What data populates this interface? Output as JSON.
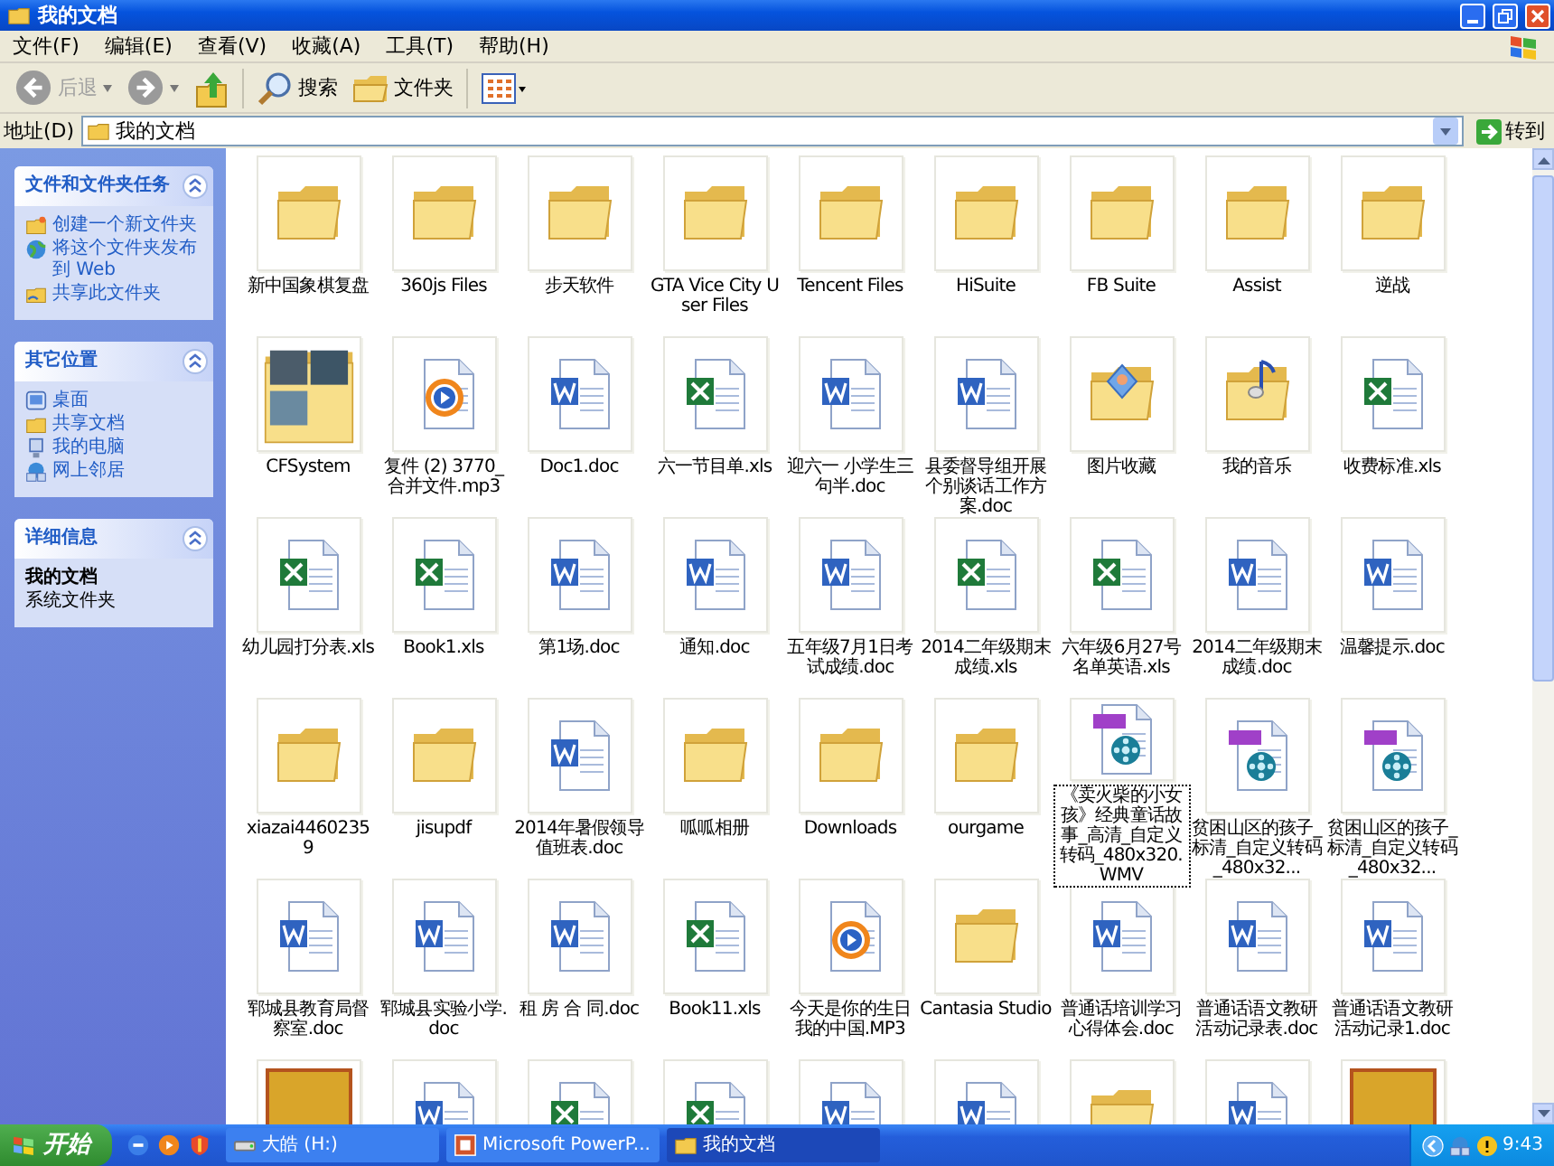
{
  "window": {
    "title": "我的文档"
  },
  "menu": [
    {
      "label": "文件(F)"
    },
    {
      "label": "编辑(E)"
    },
    {
      "label": "查看(V)"
    },
    {
      "label": "收藏(A)"
    },
    {
      "label": "工具(T)"
    },
    {
      "label": "帮助(H)"
    }
  ],
  "toolbar": [
    {
      "kind": "back",
      "label": "后退",
      "disabled": true
    },
    {
      "kind": "forward",
      "disabled": true
    },
    {
      "kind": "up",
      "disabled": false
    },
    {
      "kind": "search",
      "label": "搜索"
    },
    {
      "kind": "folders",
      "label": "文件夹"
    },
    {
      "kind": "views"
    }
  ],
  "address": {
    "label": "地址(D)",
    "value": "我的文档",
    "go": "转到"
  },
  "sidebar": [
    {
      "title": "文件和文件夹任务",
      "kind": "links",
      "items": [
        {
          "label": "创建一个新文件夹",
          "kind": "new-folder"
        },
        {
          "label": "将这个文件夹发布到 Web",
          "kind": "publish"
        },
        {
          "label": "共享此文件夹",
          "kind": "share"
        }
      ]
    },
    {
      "title": "其它位置",
      "kind": "links",
      "items": [
        {
          "label": "桌面",
          "kind": "desktop"
        },
        {
          "label": "共享文档",
          "kind": "folder"
        },
        {
          "label": "我的电脑",
          "kind": "computer"
        },
        {
          "label": "网上邻居",
          "kind": "network"
        }
      ]
    },
    {
      "title": "详细信息",
      "kind": "details",
      "name": "我的文档",
      "type": "系统文件夹"
    }
  ],
  "files": [
    {
      "name": "新中国象棋复盘",
      "kind": "folder",
      "selected": false
    },
    {
      "name": "360js Files",
      "kind": "folder",
      "selected": false
    },
    {
      "name": "步天软件",
      "kind": "folder",
      "selected": false
    },
    {
      "name": "GTA Vice City User Files",
      "kind": "folder",
      "selected": false
    },
    {
      "name": "Tencent Files",
      "kind": "folder",
      "selected": false
    },
    {
      "name": "HiSuite",
      "kind": "folder",
      "selected": false
    },
    {
      "name": "FB Suite",
      "kind": "folder",
      "selected": false
    },
    {
      "name": "Assist",
      "kind": "folder",
      "selected": false
    },
    {
      "name": "逆战",
      "kind": "folder",
      "selected": false
    },
    {
      "name": "CFSystem",
      "kind": "folder-photos",
      "selected": false
    },
    {
      "name": "复件 (2) 3770_合并文件.mp3",
      "kind": "media",
      "selected": false
    },
    {
      "name": "Doc1.doc",
      "kind": "doc",
      "selected": false
    },
    {
      "name": "六一节目单.xls",
      "kind": "xls",
      "selected": false
    },
    {
      "name": "迎六一 小学生三句半.doc",
      "kind": "doc",
      "selected": false
    },
    {
      "name": "县委督导组开展个别谈话工作方案.doc",
      "kind": "doc",
      "selected": false
    },
    {
      "name": "图片收藏",
      "kind": "folder-pictures",
      "selected": false
    },
    {
      "name": "我的音乐",
      "kind": "folder-music",
      "selected": false
    },
    {
      "name": "收费标准.xls",
      "kind": "xls",
      "selected": false
    },
    {
      "name": "幼儿园打分表.xls",
      "kind": "xls",
      "selected": false
    },
    {
      "name": "Book1.xls",
      "kind": "xls",
      "selected": false
    },
    {
      "name": "第1场.doc",
      "kind": "doc",
      "selected": false
    },
    {
      "name": "通知.doc",
      "kind": "doc",
      "selected": false
    },
    {
      "name": "五年级7月1日考试成绩.doc",
      "kind": "doc",
      "selected": false
    },
    {
      "name": "2014二年级期末成绩.xls",
      "kind": "xls",
      "selected": false
    },
    {
      "name": "六年级6月27号名单英语.xls",
      "kind": "xls",
      "selected": false
    },
    {
      "name": "2014二年级期末成绩.doc",
      "kind": "doc",
      "selected": false
    },
    {
      "name": "温馨提示.doc",
      "kind": "doc",
      "selected": false
    },
    {
      "name": "xiazai44602359",
      "kind": "folder",
      "selected": false
    },
    {
      "name": "jisupdf",
      "kind": "folder",
      "selected": false
    },
    {
      "name": "2014年暑假领导值班表.doc",
      "kind": "doc",
      "selected": false
    },
    {
      "name": "呱呱相册",
      "kind": "folder",
      "selected": false
    },
    {
      "name": "Downloads",
      "kind": "folder",
      "selected": false
    },
    {
      "name": "ourgame",
      "kind": "folder",
      "selected": false
    },
    {
      "name": "《卖火柴的小女孩》经典童话故事_高清_自定义转码_480x320.WMV",
      "kind": "video",
      "selected": true
    },
    {
      "name": "贫困山区的孩子_标清_自定义转码_480x32...",
      "kind": "video",
      "selected": false
    },
    {
      "name": "贫困山区的孩子_标清_自定义转码_480x32...",
      "kind": "video",
      "selected": false
    },
    {
      "name": "郓城县教育局督察室.doc",
      "kind": "doc",
      "selected": false
    },
    {
      "name": "郓城县实验小学.doc",
      "kind": "doc",
      "selected": false
    },
    {
      "name": "租 房 合 同.doc",
      "kind": "doc",
      "selected": false
    },
    {
      "name": "Book11.xls",
      "kind": "xls",
      "selected": false
    },
    {
      "name": "今天是你的生日我的中国.MP3",
      "kind": "media",
      "selected": false
    },
    {
      "name": "Cantasia Studio",
      "kind": "folder",
      "selected": false
    },
    {
      "name": "普通话培训学习心得体会.doc",
      "kind": "doc",
      "selected": false
    },
    {
      "name": "普通话语文教研活动记录表.doc",
      "kind": "doc",
      "selected": false
    },
    {
      "name": "普通话语文教研活动记录1.doc",
      "kind": "doc",
      "selected": false
    },
    {
      "kind": "image",
      "selected": false
    },
    {
      "kind": "doc",
      "selected": false
    },
    {
      "kind": "xls",
      "selected": false
    },
    {
      "kind": "xls",
      "selected": false
    },
    {
      "kind": "doc",
      "selected": false
    },
    {
      "kind": "doc",
      "selected": false
    },
    {
      "kind": "folder",
      "selected": false
    },
    {
      "kind": "doc",
      "selected": false
    },
    {
      "kind": "image",
      "selected": false
    }
  ],
  "taskbar": {
    "start": "开始",
    "tasks": [
      {
        "label": "大皓 (H:)",
        "kind": "drive",
        "selected": false
      },
      {
        "label": "Microsoft PowerP...",
        "kind": "powerpoint",
        "selected": false
      },
      {
        "label": "我的文档",
        "kind": "folder",
        "selected": true
      }
    ],
    "clock": "9:43"
  }
}
